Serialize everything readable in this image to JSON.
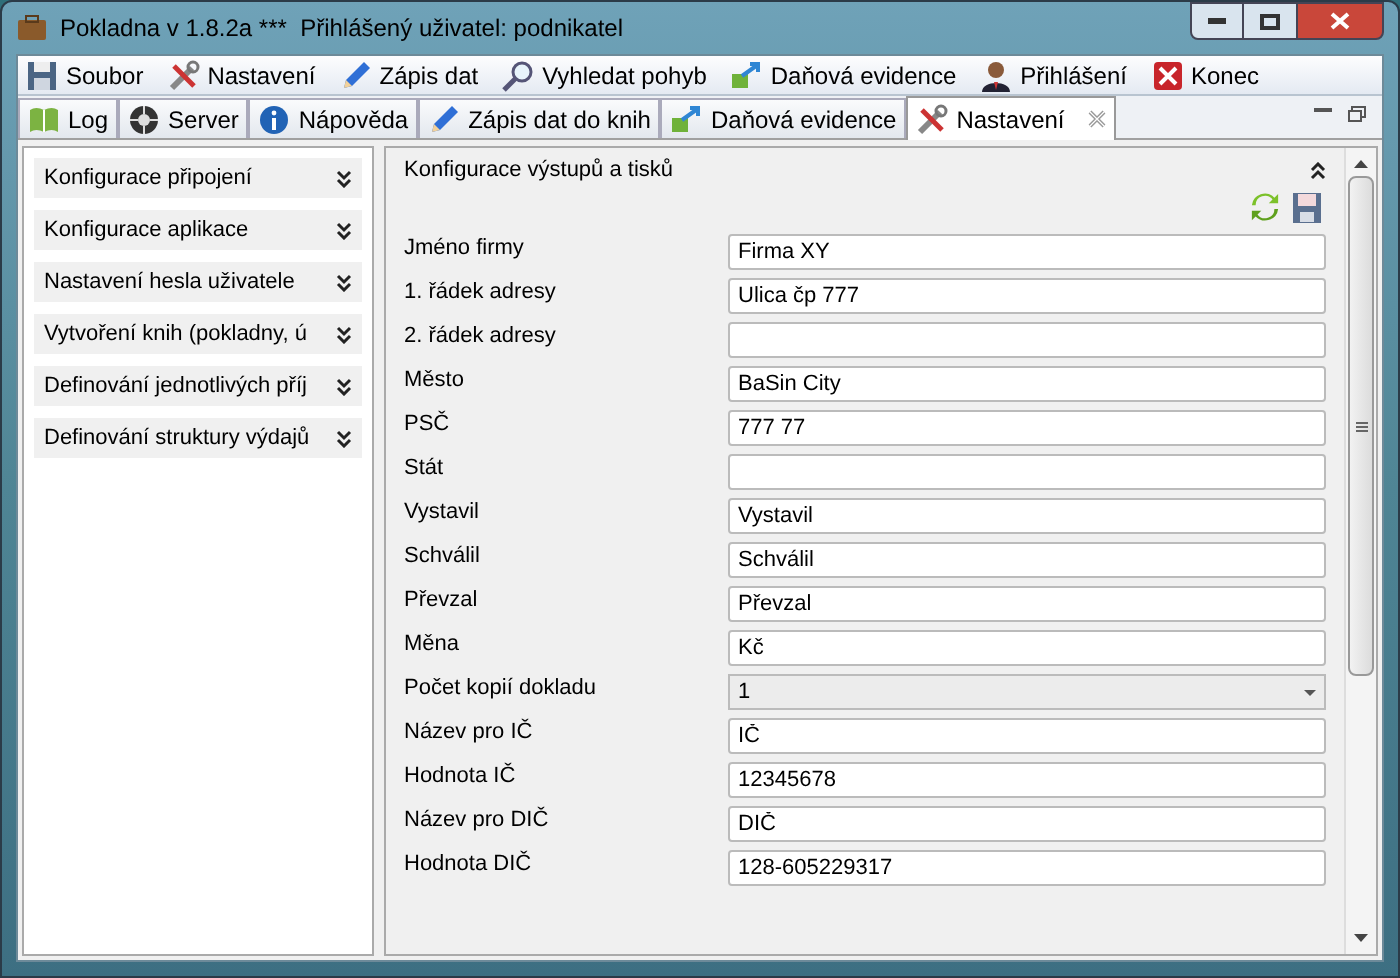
{
  "window": {
    "title": "Pokladna v 1.8.2a ***  Přihlášený uživatel: podnikatel"
  },
  "menu": [
    {
      "label": "Soubor"
    },
    {
      "label": "Nastavení"
    },
    {
      "label": "Zápis dat"
    },
    {
      "label": "Vyhledat pohyb"
    },
    {
      "label": "Daňová evidence"
    },
    {
      "label": "Přihlášení"
    },
    {
      "label": "Konec"
    }
  ],
  "tabs": [
    {
      "label": "Log",
      "selected": false,
      "closable": false
    },
    {
      "label": "Server",
      "selected": false,
      "closable": false
    },
    {
      "label": "Nápověda",
      "selected": false,
      "closable": false
    },
    {
      "label": "Zápis dat do knih",
      "selected": false,
      "closable": false
    },
    {
      "label": "Daňová evidence",
      "selected": false,
      "closable": false
    },
    {
      "label": "Nastavení",
      "selected": true,
      "closable": true
    }
  ],
  "sidebar": {
    "items": [
      {
        "label": "Konfigurace připojení",
        "expanded": false
      },
      {
        "label": "Konfigurace aplikace",
        "expanded": false
      },
      {
        "label": "Nastavení hesla uživatele",
        "expanded": false
      },
      {
        "label": "Vytvoření knih (pokladny, ú",
        "expanded": false
      },
      {
        "label": "Definování jednotlivých příj",
        "expanded": false
      },
      {
        "label": "Definování struktury výdajů",
        "expanded": false
      }
    ]
  },
  "panel": {
    "title": "Konfigurace výstupů a tisků",
    "expanded": true,
    "fields": [
      {
        "kind": "text",
        "label": "Jméno firmy",
        "value": "Firma XY"
      },
      {
        "kind": "text",
        "label": "1. řádek adresy",
        "value": "Ulica čp 777"
      },
      {
        "kind": "text",
        "label": "2. řádek adresy"
      },
      {
        "kind": "text",
        "label": "Město",
        "value": "BaSin City"
      },
      {
        "kind": "text",
        "label": "PSČ",
        "value": "777 77"
      },
      {
        "kind": "text",
        "label": "Stát"
      },
      {
        "kind": "text",
        "label": "Vystavil",
        "value": "Vystavil"
      },
      {
        "kind": "text",
        "label": "Schválil",
        "value": "Schválil"
      },
      {
        "kind": "text",
        "label": "Převzal",
        "value": "Převzal"
      },
      {
        "kind": "text",
        "label": "Měna",
        "value": "Kč"
      },
      {
        "kind": "select",
        "label": "Počet kopií dokladu",
        "value": "1"
      },
      {
        "kind": "text",
        "label": "Název pro IČ",
        "value": "IČ"
      },
      {
        "kind": "text",
        "label": "Hodnota IČ",
        "value": "12345678"
      },
      {
        "kind": "text",
        "label": "Název pro DIČ",
        "value": "DIČ"
      },
      {
        "kind": "text",
        "label": "Hodnota DIČ",
        "value": "128-605229317"
      }
    ]
  }
}
